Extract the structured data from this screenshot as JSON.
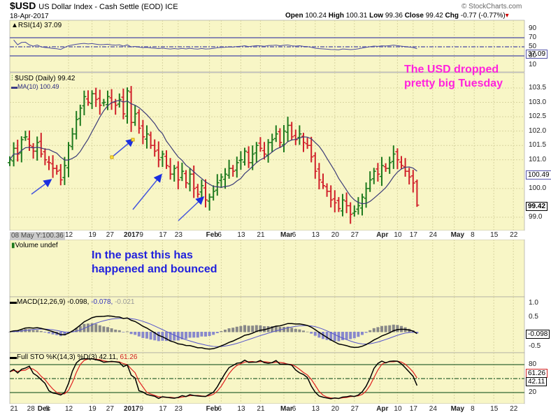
{
  "header": {
    "symbol": "$USD",
    "name": "US Dollar Index - Cash Settle (EOD) ICE",
    "date": "18-Apr-2017",
    "source": "© StockCharts.com",
    "open_label": "Open",
    "open": "100.24",
    "high_label": "High",
    "high": "100.31",
    "low_label": "Low",
    "low": "99.36",
    "close_label": "Close",
    "close": "99.42",
    "chg_label": "Chg",
    "chg": "-0.77 (-0.77%)"
  },
  "panels": {
    "rsi": {
      "label": "RSI(14) 37.09",
      "value": "37.09",
      "ticks": [
        "90",
        "70",
        "50",
        "30",
        "10"
      ]
    },
    "price": {
      "label": "$USD (Daily) 99.42",
      "ma_label": "MA(10) 100.49",
      "ma_value": "100.49",
      "close_value": "99.42",
      "ticks": [
        "103.5",
        "103.0",
        "102.5",
        "102.0",
        "101.5",
        "101.0",
        "100.0",
        "99.0"
      ],
      "cursor_label": "08 May Y:100.36"
    },
    "volume": {
      "label": "Volume undef"
    },
    "macd": {
      "label": "MACD(12,26,9) -0.098,",
      "signal": "-0.078,",
      "hist": "-0.021",
      "value": "-0.098",
      "ticks": [
        "1.0",
        "0.5",
        "-0.5"
      ]
    },
    "sto": {
      "label": "Full STO %K(14,3) %D(3) 42.11,",
      "d": "61.26",
      "k_value": "42.11",
      "d_value": "61.26",
      "ticks": [
        "80",
        "20"
      ]
    }
  },
  "annotations": {
    "usd_dropped": [
      "The USD dropped",
      "pretty big Tuesday"
    ],
    "past_bounced": [
      "In the past this has",
      "happened and bounced"
    ]
  },
  "colors": {
    "bg": "#f8f6c6",
    "up": "#1e7a1e",
    "down": "#d0202a",
    "ma": "#3c3c78",
    "note_magenta": "#ff22dd",
    "note_blue": "#2222dd"
  },
  "chart_data": {
    "type": "ohlc",
    "title": "$USD US Dollar Index - Cash Settle (EOD) ICE",
    "closes": [
      101.0,
      101.4,
      101.2,
      101.7,
      101.8,
      101.5,
      101.3,
      101.6,
      101.2,
      101.0,
      100.9,
      100.7,
      100.6,
      100.3,
      100.8,
      101.5,
      101.9,
      102.4,
      102.8,
      103.2,
      103.0,
      103.3,
      103.1,
      102.9,
      103.0,
      103.2,
      103.0,
      102.9,
      103.1,
      102.6,
      103.4,
      102.3,
      102.6,
      102.1,
      101.8,
      101.9,
      101.5,
      101.3,
      101.0,
      101.2,
      100.8,
      100.5,
      100.7,
      100.3,
      100.6,
      100.2,
      100.5,
      100.0,
      99.8,
      100.1,
      99.6,
      99.7,
      99.9,
      100.2,
      100.4,
      100.5,
      100.7,
      100.6,
      100.9,
      101.0,
      101.3,
      100.9,
      101.2,
      101.5,
      101.4,
      101.2,
      101.6,
      101.7,
      101.9,
      101.6,
      102.0,
      102.2,
      101.8,
      101.7,
      101.9,
      101.6,
      101.5,
      101.1,
      100.6,
      100.3,
      100.1,
      99.9,
      99.6,
      99.5,
      99.3,
      99.6,
      99.4,
      99.1,
      99.2,
      99.4,
      99.7,
      100.0,
      100.3,
      100.6,
      100.5,
      100.8,
      100.7,
      100.9,
      101.2,
      101.0,
      100.8,
      100.6,
      100.4,
      100.19,
      99.42
    ],
    "last_bar": {
      "open": 100.24,
      "high": 100.31,
      "low": 99.36,
      "close": 99.42
    },
    "ylim": [
      98.6,
      104.0
    ],
    "top_axis": [
      {
        "label": "12",
        "i": 15
      },
      {
        "label": "19",
        "i": 21
      },
      {
        "label": "27",
        "i": 25.5
      },
      {
        "label": "2017",
        "i": 30,
        "bold": true
      },
      {
        "label": "9",
        "i": 34
      },
      {
        "label": "17",
        "i": 39
      },
      {
        "label": "23",
        "i": 43
      },
      {
        "label": "Feb",
        "i": 51,
        "bold": true
      },
      {
        "label": "6",
        "i": 54
      },
      {
        "label": "13",
        "i": 59
      },
      {
        "label": "21",
        "i": 64
      },
      {
        "label": "Mar",
        "i": 70,
        "bold": true
      },
      {
        "label": "6",
        "i": 73
      },
      {
        "label": "13",
        "i": 78
      },
      {
        "label": "20",
        "i": 83
      },
      {
        "label": "27",
        "i": 88
      },
      {
        "label": "Apr",
        "i": 94.5,
        "bold": true
      },
      {
        "label": "10",
        "i": 99
      },
      {
        "label": "17",
        "i": 103
      },
      {
        "label": "24",
        "i": 108
      },
      {
        "label": "May",
        "i": 113.5,
        "bold": true
      },
      {
        "label": "8",
        "i": 118.6
      },
      {
        "label": "15",
        "i": 123.6
      },
      {
        "label": "22",
        "i": 128.6
      }
    ],
    "bottom_axis": [
      {
        "label": "21",
        "i": 1
      },
      {
        "label": "28",
        "i": 5.3
      },
      {
        "label": "Dec",
        "i": 8,
        "bold": true
      },
      {
        "label": "5",
        "i": 10
      },
      {
        "label": "12",
        "i": 15
      },
      {
        "label": "19",
        "i": 21
      },
      {
        "label": "27",
        "i": 25.5
      },
      {
        "label": "2017",
        "i": 30,
        "bold": true
      },
      {
        "label": "9",
        "i": 34
      },
      {
        "label": "17",
        "i": 39
      },
      {
        "label": "23",
        "i": 43
      },
      {
        "label": "Feb",
        "i": 51,
        "bold": true
      },
      {
        "label": "6",
        "i": 54
      },
      {
        "label": "13",
        "i": 59
      },
      {
        "label": "21",
        "i": 64
      },
      {
        "label": "Mar",
        "i": 70,
        "bold": true
      },
      {
        "label": "6",
        "i": 73
      },
      {
        "label": "13",
        "i": 78
      },
      {
        "label": "20",
        "i": 83
      },
      {
        "label": "27",
        "i": 88
      },
      {
        "label": "Apr",
        "i": 94.5,
        "bold": true
      },
      {
        "label": "10",
        "i": 99
      },
      {
        "label": "17",
        "i": 103
      },
      {
        "label": "24",
        "i": 108
      },
      {
        "label": "May",
        "i": 113.5,
        "bold": true
      },
      {
        "label": "8",
        "i": 118.6
      },
      {
        "label": "15",
        "i": 123.6
      },
      {
        "label": "22",
        "i": 128.6
      }
    ]
  }
}
